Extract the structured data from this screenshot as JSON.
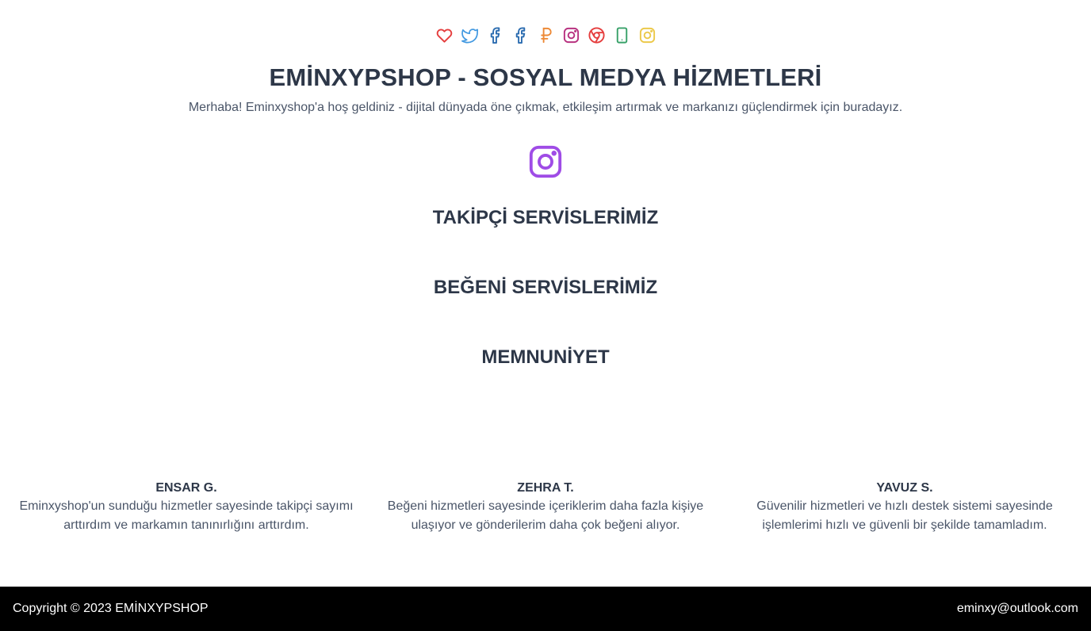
{
  "social_icons": [
    {
      "name": "heart-icon",
      "color": "#e53e3e"
    },
    {
      "name": "twitter-icon",
      "color": "#4299e1"
    },
    {
      "name": "facebook-icon",
      "color": "#2b6cb0"
    },
    {
      "name": "facebook-icon",
      "color": "#2b6cb0"
    },
    {
      "name": "ruble-icon",
      "color": "#ed8936"
    },
    {
      "name": "instagram-icon",
      "color": "#b83280"
    },
    {
      "name": "chrome-icon",
      "color": "#e53e3e"
    },
    {
      "name": "phone-icon",
      "color": "#38a169"
    },
    {
      "name": "instagram-icon",
      "color": "#ecc94b"
    }
  ],
  "header": {
    "title": "EMİNXYPSHOP - SOSYAL MEDYA HİZMETLERİ",
    "subtitle": "Merhaba! Eminxyshop'a hoş geldiniz - dijital dünyada öne çıkmak, etkileşim artırmak ve markanızı güçlendirmek için buradayız."
  },
  "hero_icon": {
    "name": "instagram-icon",
    "color": "#9f4ce6"
  },
  "sections": {
    "followers": "TAKİPÇİ SERVİSLERİMİZ",
    "likes": "BEĞENİ SERVİSLERİMİZ",
    "satisfaction": "MEMNUNİYET"
  },
  "testimonials": [
    {
      "name": "ENSAR G.",
      "quote": "Eminxyshop'un sunduğu hizmetler sayesinde takipçi sayımı arttırdım ve markamın tanınırlığını arttırdım."
    },
    {
      "name": "ZEHRA T.",
      "quote": "Beğeni hizmetleri sayesinde içeriklerim daha fazla kişiye ulaşıyor ve gönderilerim daha çok beğeni alıyor."
    },
    {
      "name": "YAVUZ S.",
      "quote": "Güvenilir hizmetleri ve hızlı destek sistemi sayesinde işlemlerimi hızlı ve güvenli bir şekilde tamamladım."
    }
  ],
  "footer": {
    "copyright": "Copyright © 2023 EMİNXYPSHOP",
    "email": "eminxy@outlook.com"
  }
}
